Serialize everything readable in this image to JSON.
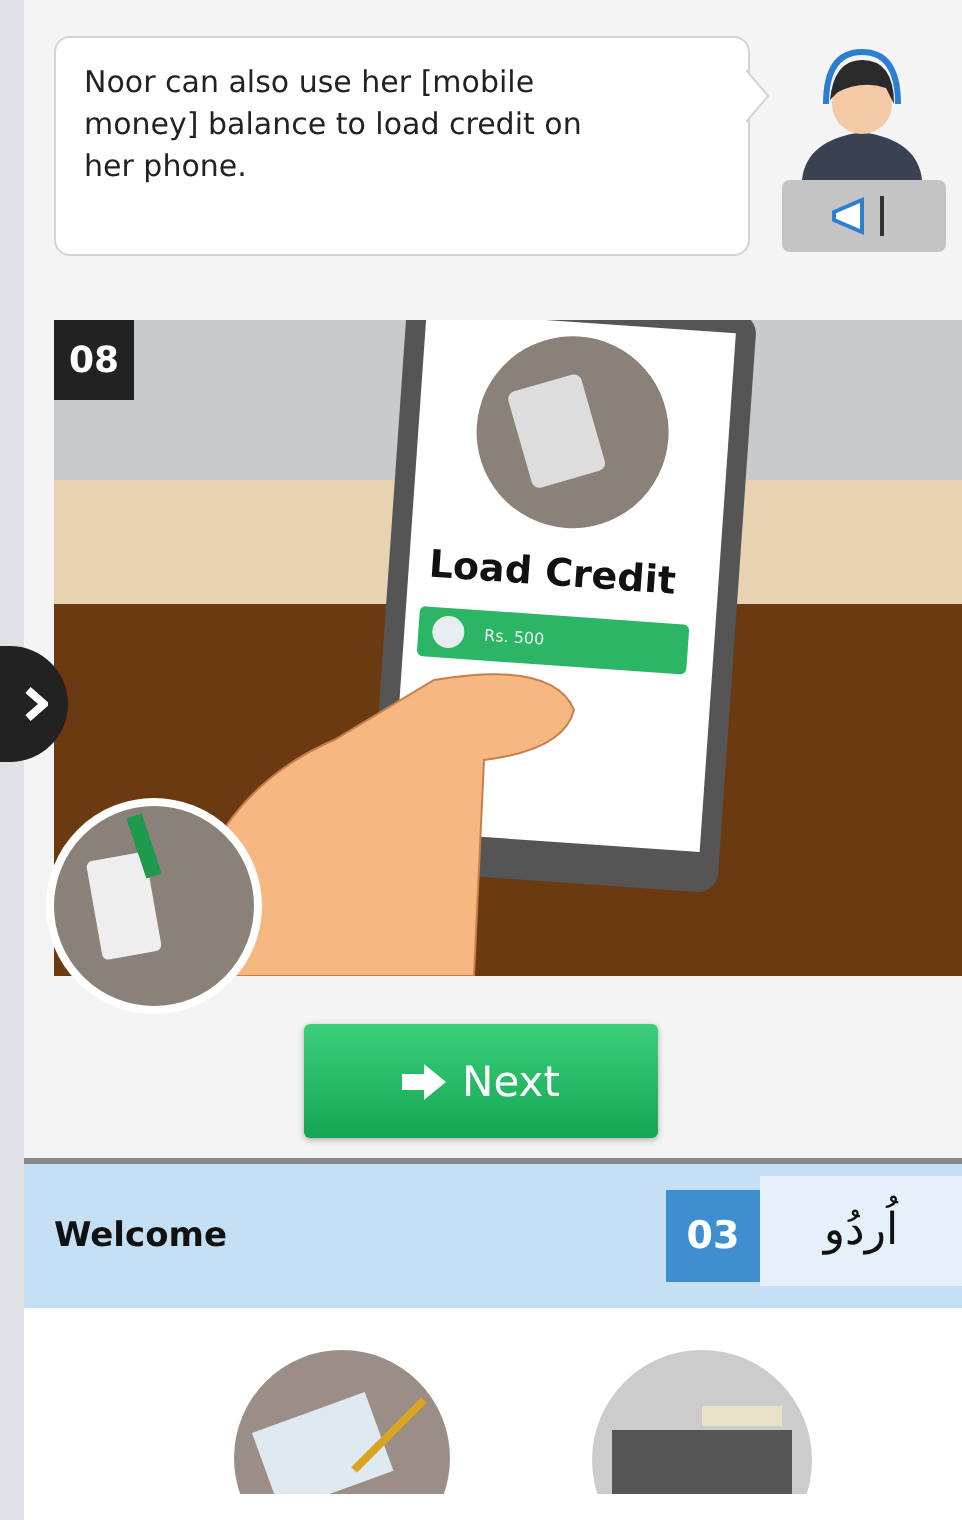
{
  "message": {
    "text": "Noor can also use her [mobile money] balance to load credit on her phone."
  },
  "lesson": {
    "step_badge": "08",
    "screen_title": "Load Credit",
    "amount": "Rs. 500"
  },
  "next_button": {
    "label": "Next"
  },
  "header": {
    "title": "Welcome",
    "count_badge": "03",
    "language": "اُردُو"
  }
}
